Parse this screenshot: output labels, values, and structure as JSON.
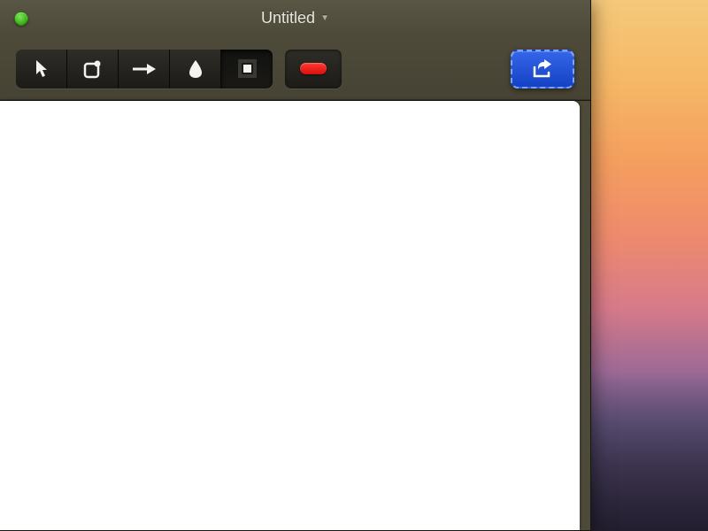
{
  "window": {
    "title": "Untitled"
  },
  "toolbar": {
    "tools": [
      {
        "name": "pointer",
        "active": false
      },
      {
        "name": "shape",
        "active": false
      },
      {
        "name": "arrow",
        "active": false
      },
      {
        "name": "blur",
        "active": false
      },
      {
        "name": "crop",
        "active": true
      }
    ],
    "color_indicator": "#ff1a1a",
    "share_label": "Share"
  },
  "colors": {
    "share_button": "#2a56db",
    "traffic_zoom": "#3fb51e"
  }
}
